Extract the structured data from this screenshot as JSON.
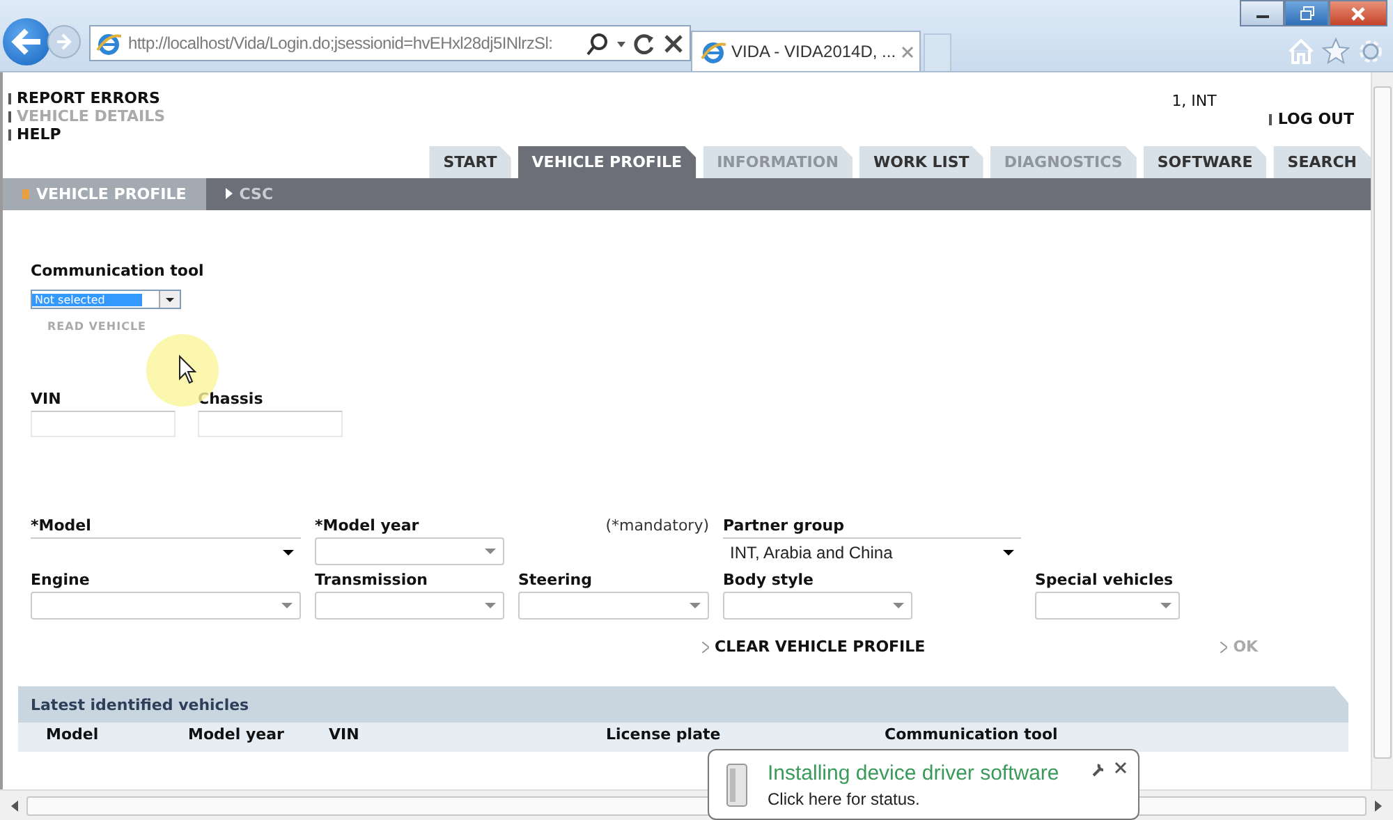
{
  "browser": {
    "address": "http://localhost/Vida/Login.do;jsessionid=hvEHxl28dj5INlrzSl:",
    "tab_title": "VIDA - VIDA2014D, ..."
  },
  "top_links": [
    {
      "label": "REPORT ERRORS",
      "disabled": false
    },
    {
      "label": "VEHICLE DETAILS",
      "disabled": true
    },
    {
      "label": "HELP",
      "disabled": false
    }
  ],
  "user": "1, INT",
  "logout": "LOG OUT",
  "tabs": [
    {
      "label": "START",
      "selected": false,
      "disabled": false
    },
    {
      "label": "VEHICLE PROFILE",
      "selected": true,
      "disabled": false
    },
    {
      "label": "INFORMATION",
      "selected": false,
      "disabled": true
    },
    {
      "label": "WORK LIST",
      "selected": false,
      "disabled": false
    },
    {
      "label": "DIAGNOSTICS",
      "selected": false,
      "disabled": true
    },
    {
      "label": "SOFTWARE",
      "selected": false,
      "disabled": false
    },
    {
      "label": "SEARCH",
      "selected": false,
      "disabled": false
    }
  ],
  "subtabs": [
    {
      "label": "VEHICLE PROFILE",
      "selected": true
    },
    {
      "label": "CSC",
      "selected": false
    }
  ],
  "communication_tool": {
    "label": "Communication tool",
    "value": "Not selected"
  },
  "read_vehicle": {
    "label": "READ VEHICLE",
    "disabled": true
  },
  "id_fields": [
    {
      "label": "VIN"
    },
    {
      "label": "Chassis"
    }
  ],
  "mandatory_note": "(*mandatory)",
  "selects_row_1": [
    {
      "label": "*Model",
      "kind": "plain"
    },
    {
      "label": "*Model year",
      "kind": "boxed"
    },
    {
      "label": "Partner group",
      "kind": "plain",
      "value": "INT, Arabia and China"
    }
  ],
  "selects_row_2": [
    {
      "label": "Engine",
      "kind": "boxed"
    },
    {
      "label": "Transmission",
      "kind": "boxed"
    },
    {
      "label": "Steering",
      "kind": "boxed"
    },
    {
      "label": "Body style",
      "kind": "boxed"
    },
    {
      "label": "Special vehicles",
      "kind": "boxed"
    }
  ],
  "actions": [
    {
      "label": "CLEAR VEHICLE PROFILE",
      "disabled": false
    },
    {
      "label": "OK",
      "disabled": true
    }
  ],
  "latest": {
    "title": "Latest identified vehicles",
    "columns": [
      "Model",
      "Model year",
      "VIN",
      "License plate",
      "Communication tool"
    ]
  },
  "notification": {
    "title": "Installing device driver software",
    "text": "Click here for status."
  }
}
